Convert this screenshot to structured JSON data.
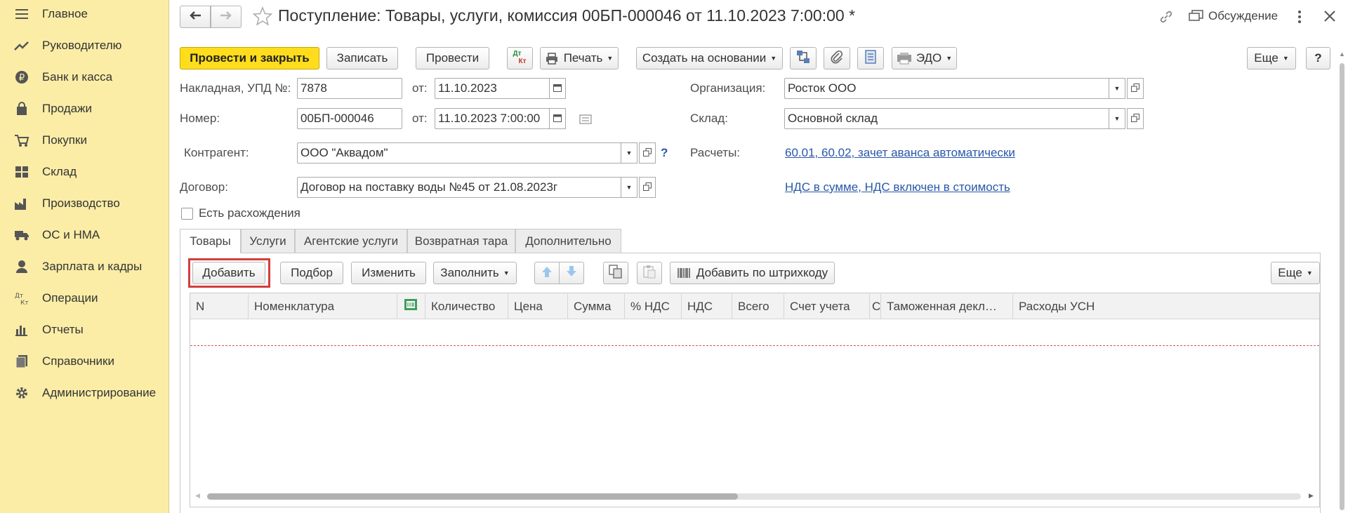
{
  "sidebar": {
    "items": [
      {
        "label": "Главное",
        "icon": "menu-icon"
      },
      {
        "label": "Руководителю",
        "icon": "trend-icon"
      },
      {
        "label": "Банк и касса",
        "icon": "ruble-icon"
      },
      {
        "label": "Продажи",
        "icon": "bag-icon"
      },
      {
        "label": "Покупки",
        "icon": "cart-icon"
      },
      {
        "label": "Склад",
        "icon": "warehouse-icon"
      },
      {
        "label": "Производство",
        "icon": "factory-icon"
      },
      {
        "label": "ОС и НМА",
        "icon": "truck-icon"
      },
      {
        "label": "Зарплата и кадры",
        "icon": "person-icon"
      },
      {
        "label": "Операции",
        "icon": "dt-kt-icon"
      },
      {
        "label": "Отчеты",
        "icon": "bar-chart-icon"
      },
      {
        "label": "Справочники",
        "icon": "books-icon"
      },
      {
        "label": "Администрирование",
        "icon": "gear-icon"
      }
    ]
  },
  "header": {
    "title": "Поступление: Товары, услуги, комиссия 00БП-000046 от 11.10.2023 7:00:00 *",
    "discussion": "Обсуждение"
  },
  "toolbar": {
    "post_close": "Провести и закрыть",
    "save": "Записать",
    "post": "Провести",
    "dt": "Дт",
    "kt": "Кт",
    "print": "Печать",
    "create_based": "Создать на основании",
    "edo": "ЭДО",
    "more": "Еще",
    "help": "?"
  },
  "form": {
    "invoice_label": "Накладная, УПД №:",
    "invoice_value": "7878",
    "from_label": "от:",
    "invoice_date": "11.10.2023",
    "number_label": "Номер:",
    "number_value": "00БП-000046",
    "number_date": "11.10.2023  7:00:00",
    "org_label": "Организация:",
    "org_value": "Росток ООО",
    "warehouse_label": "Склад:",
    "warehouse_value": "Основной склад",
    "counterparty_label": "Контрагент:",
    "counterparty_value": "ООО \"Аквадом\"",
    "help_mark": "?",
    "settlements_label": "Расчеты:",
    "settlements_link": "60.01, 60.02, зачет аванса автоматически",
    "contract_label": "Договор:",
    "contract_value": "Договор на поставку воды №45 от 21.08.2023г",
    "vat_link": "НДС в сумме, НДС включен в стоимость",
    "discrepancy_label": "Есть расхождения"
  },
  "tabs": [
    "Товары",
    "Услуги",
    "Агентские услуги",
    "Возвратная тара",
    "Дополнительно"
  ],
  "table_toolbar": {
    "add": "Добавить",
    "selection": "Подбор",
    "edit": "Изменить",
    "fill": "Заполнить",
    "add_barcode": "Добавить по штрихкоду",
    "more": "Еще"
  },
  "table": {
    "columns": [
      "N",
      "Номенклатура",
      "",
      "Количество",
      "Цена",
      "Сумма",
      "% НДС",
      "НДС",
      "Всего",
      "Счет учета",
      "С",
      "Таможенная декл…",
      "Расходы УСН"
    ]
  },
  "colors": {
    "sidebar_bg": "#fbeda6",
    "primary_button": "#ffdd1c",
    "link": "#2958a8",
    "highlight_border": "#d43d3d"
  }
}
